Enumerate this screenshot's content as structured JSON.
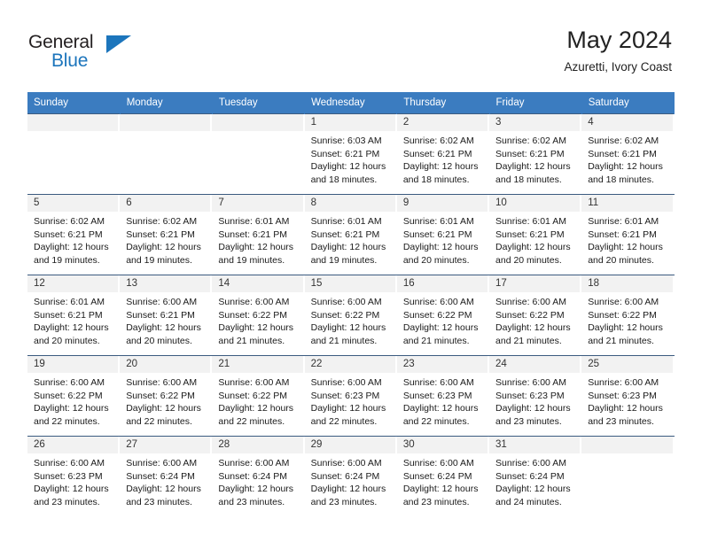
{
  "logo": {
    "line1": "General",
    "line2": "Blue",
    "accent_color": "#1c75bc",
    "triangle_icon": "triangle-icon"
  },
  "header": {
    "title": "May 2024",
    "subtitle": "Azuretti, Ivory Coast"
  },
  "colors": {
    "header_bar": "#3b7cc0",
    "day_band": "#f2f2f2",
    "grid_line": "#3b5b80",
    "text": "#1a1a1a"
  },
  "weekdays": [
    "Sunday",
    "Monday",
    "Tuesday",
    "Wednesday",
    "Thursday",
    "Friday",
    "Saturday"
  ],
  "labels": {
    "sunrise_prefix": "Sunrise: ",
    "sunset_prefix": "Sunset: ",
    "daylight_prefix": "Daylight: "
  },
  "weeks": [
    [
      {
        "empty": true
      },
      {
        "empty": true
      },
      {
        "empty": true
      },
      {
        "day": "1",
        "sunrise": "Sunrise: 6:03 AM",
        "sunset": "Sunset: 6:21 PM",
        "daylight": "Daylight: 12 hours and 18 minutes."
      },
      {
        "day": "2",
        "sunrise": "Sunrise: 6:02 AM",
        "sunset": "Sunset: 6:21 PM",
        "daylight": "Daylight: 12 hours and 18 minutes."
      },
      {
        "day": "3",
        "sunrise": "Sunrise: 6:02 AM",
        "sunset": "Sunset: 6:21 PM",
        "daylight": "Daylight: 12 hours and 18 minutes."
      },
      {
        "day": "4",
        "sunrise": "Sunrise: 6:02 AM",
        "sunset": "Sunset: 6:21 PM",
        "daylight": "Daylight: 12 hours and 18 minutes."
      }
    ],
    [
      {
        "day": "5",
        "sunrise": "Sunrise: 6:02 AM",
        "sunset": "Sunset: 6:21 PM",
        "daylight": "Daylight: 12 hours and 19 minutes."
      },
      {
        "day": "6",
        "sunrise": "Sunrise: 6:02 AM",
        "sunset": "Sunset: 6:21 PM",
        "daylight": "Daylight: 12 hours and 19 minutes."
      },
      {
        "day": "7",
        "sunrise": "Sunrise: 6:01 AM",
        "sunset": "Sunset: 6:21 PM",
        "daylight": "Daylight: 12 hours and 19 minutes."
      },
      {
        "day": "8",
        "sunrise": "Sunrise: 6:01 AM",
        "sunset": "Sunset: 6:21 PM",
        "daylight": "Daylight: 12 hours and 19 minutes."
      },
      {
        "day": "9",
        "sunrise": "Sunrise: 6:01 AM",
        "sunset": "Sunset: 6:21 PM",
        "daylight": "Daylight: 12 hours and 20 minutes."
      },
      {
        "day": "10",
        "sunrise": "Sunrise: 6:01 AM",
        "sunset": "Sunset: 6:21 PM",
        "daylight": "Daylight: 12 hours and 20 minutes."
      },
      {
        "day": "11",
        "sunrise": "Sunrise: 6:01 AM",
        "sunset": "Sunset: 6:21 PM",
        "daylight": "Daylight: 12 hours and 20 minutes."
      }
    ],
    [
      {
        "day": "12",
        "sunrise": "Sunrise: 6:01 AM",
        "sunset": "Sunset: 6:21 PM",
        "daylight": "Daylight: 12 hours and 20 minutes."
      },
      {
        "day": "13",
        "sunrise": "Sunrise: 6:00 AM",
        "sunset": "Sunset: 6:21 PM",
        "daylight": "Daylight: 12 hours and 20 minutes."
      },
      {
        "day": "14",
        "sunrise": "Sunrise: 6:00 AM",
        "sunset": "Sunset: 6:22 PM",
        "daylight": "Daylight: 12 hours and 21 minutes."
      },
      {
        "day": "15",
        "sunrise": "Sunrise: 6:00 AM",
        "sunset": "Sunset: 6:22 PM",
        "daylight": "Daylight: 12 hours and 21 minutes."
      },
      {
        "day": "16",
        "sunrise": "Sunrise: 6:00 AM",
        "sunset": "Sunset: 6:22 PM",
        "daylight": "Daylight: 12 hours and 21 minutes."
      },
      {
        "day": "17",
        "sunrise": "Sunrise: 6:00 AM",
        "sunset": "Sunset: 6:22 PM",
        "daylight": "Daylight: 12 hours and 21 minutes."
      },
      {
        "day": "18",
        "sunrise": "Sunrise: 6:00 AM",
        "sunset": "Sunset: 6:22 PM",
        "daylight": "Daylight: 12 hours and 21 minutes."
      }
    ],
    [
      {
        "day": "19",
        "sunrise": "Sunrise: 6:00 AM",
        "sunset": "Sunset: 6:22 PM",
        "daylight": "Daylight: 12 hours and 22 minutes."
      },
      {
        "day": "20",
        "sunrise": "Sunrise: 6:00 AM",
        "sunset": "Sunset: 6:22 PM",
        "daylight": "Daylight: 12 hours and 22 minutes."
      },
      {
        "day": "21",
        "sunrise": "Sunrise: 6:00 AM",
        "sunset": "Sunset: 6:22 PM",
        "daylight": "Daylight: 12 hours and 22 minutes."
      },
      {
        "day": "22",
        "sunrise": "Sunrise: 6:00 AM",
        "sunset": "Sunset: 6:23 PM",
        "daylight": "Daylight: 12 hours and 22 minutes."
      },
      {
        "day": "23",
        "sunrise": "Sunrise: 6:00 AM",
        "sunset": "Sunset: 6:23 PM",
        "daylight": "Daylight: 12 hours and 22 minutes."
      },
      {
        "day": "24",
        "sunrise": "Sunrise: 6:00 AM",
        "sunset": "Sunset: 6:23 PM",
        "daylight": "Daylight: 12 hours and 23 minutes."
      },
      {
        "day": "25",
        "sunrise": "Sunrise: 6:00 AM",
        "sunset": "Sunset: 6:23 PM",
        "daylight": "Daylight: 12 hours and 23 minutes."
      }
    ],
    [
      {
        "day": "26",
        "sunrise": "Sunrise: 6:00 AM",
        "sunset": "Sunset: 6:23 PM",
        "daylight": "Daylight: 12 hours and 23 minutes."
      },
      {
        "day": "27",
        "sunrise": "Sunrise: 6:00 AM",
        "sunset": "Sunset: 6:24 PM",
        "daylight": "Daylight: 12 hours and 23 minutes."
      },
      {
        "day": "28",
        "sunrise": "Sunrise: 6:00 AM",
        "sunset": "Sunset: 6:24 PM",
        "daylight": "Daylight: 12 hours and 23 minutes."
      },
      {
        "day": "29",
        "sunrise": "Sunrise: 6:00 AM",
        "sunset": "Sunset: 6:24 PM",
        "daylight": "Daylight: 12 hours and 23 minutes."
      },
      {
        "day": "30",
        "sunrise": "Sunrise: 6:00 AM",
        "sunset": "Sunset: 6:24 PM",
        "daylight": "Daylight: 12 hours and 23 minutes."
      },
      {
        "day": "31",
        "sunrise": "Sunrise: 6:00 AM",
        "sunset": "Sunset: 6:24 PM",
        "daylight": "Daylight: 12 hours and 24 minutes."
      },
      {
        "empty": true
      }
    ]
  ]
}
